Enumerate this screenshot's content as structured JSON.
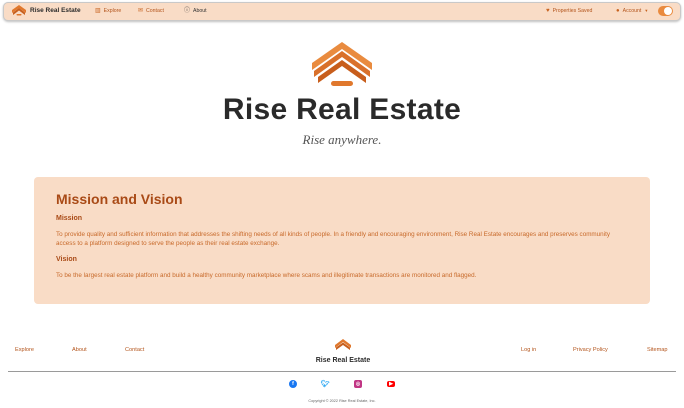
{
  "nav": {
    "brand": "Rise Real Estate",
    "links": [
      {
        "label": "Explore",
        "icon": "building-icon"
      },
      {
        "label": "Contact",
        "icon": "mail-icon"
      },
      {
        "label": "About",
        "icon": "info-icon"
      }
    ],
    "properties_saved": "Properties Saved",
    "account": "Account"
  },
  "hero": {
    "title": "Rise Real Estate",
    "tagline": "Rise anywhere."
  },
  "mission": {
    "heading": "Mission and Vision",
    "mission_label": "Mission",
    "mission_text": "To provide quality and sufficient information that addresses the shifting needs of all kinds of people. In a friendly and encouraging environment, Rise Real Estate encourages and preserves community access to a platform designed to serve the people as their real estate exchange.",
    "vision_label": "Vision",
    "vision_text": "To be the largest real estate platform and build a healthy community marketplace where scams and illegitimate transactions are monitored and flagged."
  },
  "footer": {
    "left_links": [
      "Explore",
      "About",
      "Contact"
    ],
    "brand": "Rise Real Estate",
    "right_links": [
      "Log in",
      "Privacy Policy",
      "Sitemap"
    ],
    "copyright": "Copyright © 2022 Rise Real Estate, Inc."
  },
  "colors": {
    "accent": "#e0782d",
    "panel": "#f9dcc6",
    "link": "#b3541b"
  }
}
